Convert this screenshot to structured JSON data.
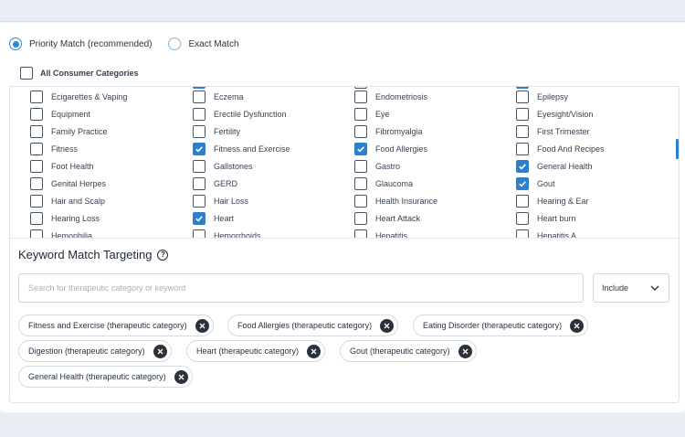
{
  "match_mode": {
    "priority_label": "Priority Match (recommended)",
    "exact_label": "Exact Match",
    "selected": "priority"
  },
  "all_categories_label": "All Consumer Categories",
  "categories": [
    [
      {
        "label": "Ecigarettes & Vaping",
        "checked": false
      },
      {
        "label": "Equipment",
        "checked": false
      },
      {
        "label": "Family Practice",
        "checked": false
      },
      {
        "label": "Fitness",
        "checked": false
      },
      {
        "label": "Foot Health",
        "checked": false
      },
      {
        "label": "Genital Herpes",
        "checked": false
      },
      {
        "label": "Hair and Scalp",
        "checked": false
      },
      {
        "label": "Hearing Loss",
        "checked": false
      },
      {
        "label": "Hemophilia",
        "checked": false
      }
    ],
    [
      {
        "label": "Eczema",
        "checked": false
      },
      {
        "label": "Erectile Dysfunction",
        "checked": false
      },
      {
        "label": "Fertility",
        "checked": false
      },
      {
        "label": "Fitness and Exercise",
        "checked": true
      },
      {
        "label": "Gallstones",
        "checked": false
      },
      {
        "label": "GERD",
        "checked": false
      },
      {
        "label": "Hair Loss",
        "checked": false
      },
      {
        "label": "Heart",
        "checked": true
      },
      {
        "label": "Hemorrhoids",
        "checked": false
      }
    ],
    [
      {
        "label": "Endometriosis",
        "checked": false
      },
      {
        "label": "Eye",
        "checked": false
      },
      {
        "label": "Fibromyalgia",
        "checked": false
      },
      {
        "label": "Food Allergies",
        "checked": true
      },
      {
        "label": "Gastro",
        "checked": false
      },
      {
        "label": "Glaucoma",
        "checked": false
      },
      {
        "label": "Health Insurance",
        "checked": false
      },
      {
        "label": "Heart Attack",
        "checked": false
      },
      {
        "label": "Hepatitis",
        "checked": false
      }
    ],
    [
      {
        "label": "Epilepsy",
        "checked": false
      },
      {
        "label": "Eyesight/Vision",
        "checked": false
      },
      {
        "label": "First Trimester",
        "checked": false
      },
      {
        "label": "Food And Recipes",
        "checked": false
      },
      {
        "label": "General Health",
        "checked": true
      },
      {
        "label": "Gout",
        "checked": true
      },
      {
        "label": "Hearing & Ear",
        "checked": false
      },
      {
        "label": "Heart burn",
        "checked": false
      },
      {
        "label": "Hepatitis A",
        "checked": false
      }
    ]
  ],
  "keyword": {
    "title": "Keyword Match Targeting",
    "help_glyph": "?",
    "search_placeholder": "Search for therapeutic category or keyword",
    "mode_value": "Include",
    "chips": [
      "Fitness and Exercise (therapeutic category)",
      "Food Allergies (therapeutic category)",
      "Eating Disorder (therapeutic category)",
      "Digestion (therapeutic category)",
      "Heart (therapeutic category)",
      "Gout (therapeutic category)",
      "General Health (therapeutic category)"
    ]
  },
  "icons": {
    "check": "check-icon",
    "remove": "close-icon",
    "dropdown": "chevron-down-icon",
    "help": "help-circle-icon"
  },
  "colors": {
    "accent": "#2f7fcd",
    "radio": "#2f8ad6",
    "chip_close_bg": "#2a323c"
  }
}
